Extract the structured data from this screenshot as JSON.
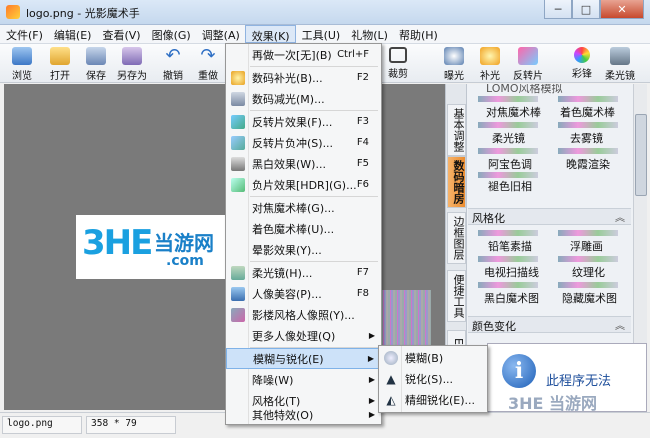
{
  "window": {
    "title": "logo.png - 光影魔术手",
    "minimize": "─",
    "maximize": "□",
    "close": "✕"
  },
  "menubar": [
    "文件(F)",
    "编辑(E)",
    "查看(V)",
    "图像(G)",
    "调整(A)",
    "效果(K)",
    "工具(U)",
    "礼物(L)",
    "帮助(H)"
  ],
  "toolbar_left": [
    "浏览",
    "打开",
    "保存",
    "另存为",
    "撤销",
    "重做"
  ],
  "toolbar_right": [
    "裁剪",
    "曝光",
    "补光",
    "反转片",
    "彩锋",
    "柔光镜"
  ],
  "effects_menu": [
    {
      "label": "再做一次[无](B)",
      "key": "Ctrl+F"
    },
    {
      "label": "数码补光(B)...",
      "key": "F2",
      "icon": "bulb-icon"
    },
    {
      "label": "数码减光(M)...",
      "key": "",
      "icon": "dim-icon"
    },
    {
      "label": "反转片效果(F)...",
      "key": "F3",
      "icon": "film-icon"
    },
    {
      "label": "反转片负冲(S)...",
      "key": "F4",
      "icon": "film-icon"
    },
    {
      "label": "黑白效果(W)...",
      "key": "F5",
      "icon": "bw-icon"
    },
    {
      "label": "负片效果[HDR](G)...",
      "key": "F6",
      "icon": "hdr-icon"
    },
    {
      "label": "对焦魔术棒(G)...",
      "key": ""
    },
    {
      "label": "着色魔术棒(U)...",
      "key": ""
    },
    {
      "label": "晕影效果(Y)...",
      "key": ""
    },
    {
      "label": "柔光镜(H)...",
      "key": "F7",
      "icon": "softlight-icon"
    },
    {
      "label": "人像美容(P)...",
      "key": "F8",
      "icon": "portrait-icon"
    },
    {
      "label": "影楼风格人像照(Y)...",
      "key": "",
      "icon": "studio-icon"
    },
    {
      "label": "更多人像处理(Q)",
      "key": "",
      "submenu": true
    },
    {
      "label": "模糊与锐化(E)",
      "key": "",
      "submenu": true
    },
    {
      "label": "降噪(W)",
      "key": "",
      "submenu": true
    },
    {
      "label": "风格化(T)",
      "key": "",
      "submenu": true
    },
    {
      "label": "其他特效(O)",
      "key": "",
      "submenu": true
    }
  ],
  "submenu": [
    {
      "label": "模糊(B)",
      "icon": "blur-icon"
    },
    {
      "label": "锐化(S)...",
      "icon": "sharpen-icon"
    },
    {
      "label": "精细锐化(E)...",
      "icon": "fine-sharpen-icon"
    }
  ],
  "side_tabs": [
    "基本调整",
    "数码暗房",
    "边框图层",
    "便捷工具",
    "E"
  ],
  "effects_panel": {
    "top_partial": "LOMO风格模拟",
    "group1": [
      [
        "对焦魔术棒",
        "着色魔术棒"
      ],
      [
        "柔光镜",
        "去雾镜"
      ],
      [
        "阿宝色调",
        "晚霞渲染"
      ],
      [
        "褪色旧相",
        ""
      ]
    ],
    "section_style": "风格化",
    "group2": [
      [
        "铅笔素描",
        "浮雕画"
      ],
      [
        "电视扫描线",
        "纹理化"
      ],
      [
        "黑白魔术图",
        "隐藏魔术图"
      ]
    ],
    "section_color": "颜色变化"
  },
  "dialog": {
    "icon": "i",
    "text": "此程序无法"
  },
  "logo": {
    "big": "3HE",
    "cn": "当游网",
    "com": ".com"
  },
  "statusbar": {
    "filename": "logo.png",
    "size": "358 * 79"
  },
  "watermark": "3HE 当游网"
}
